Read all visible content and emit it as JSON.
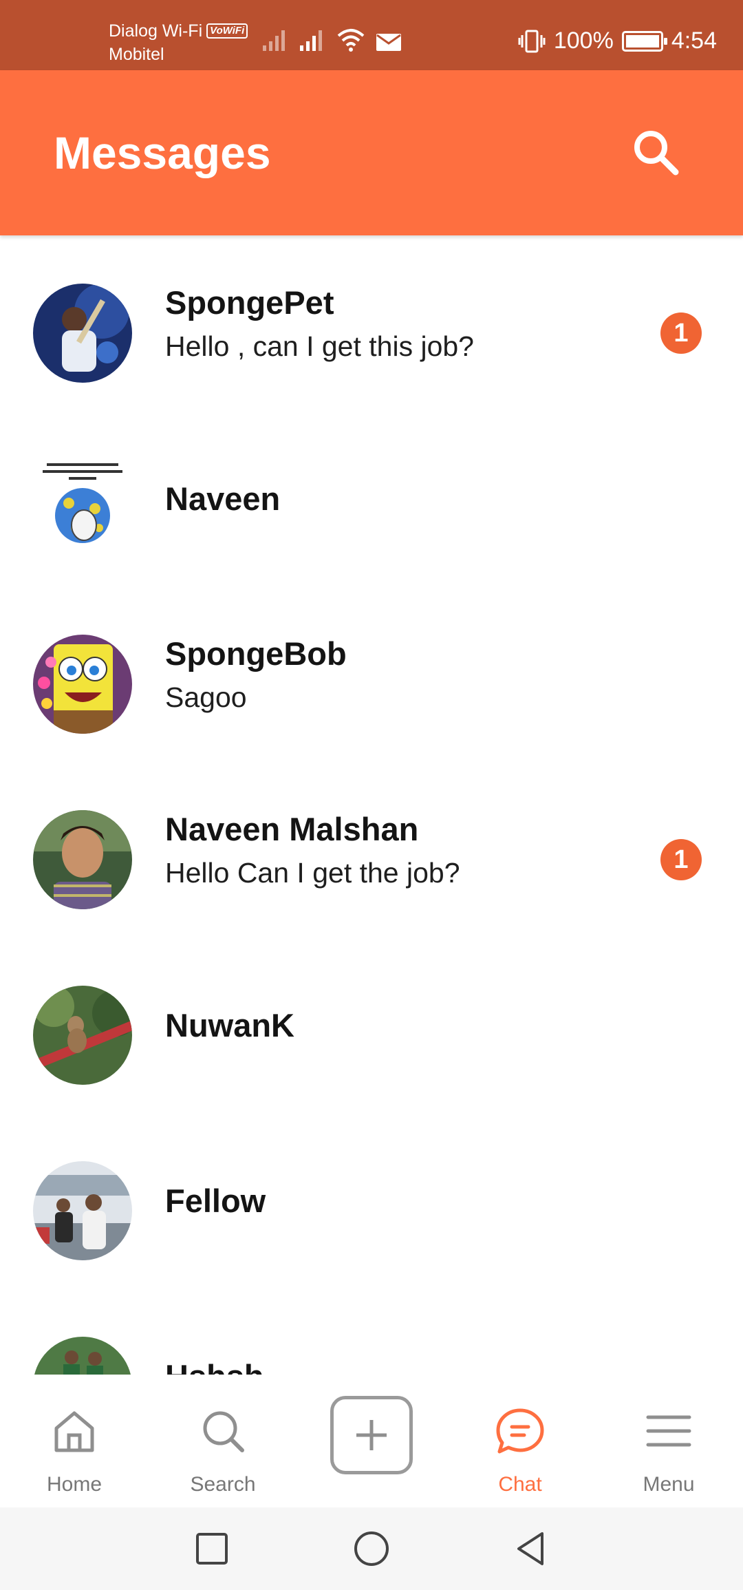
{
  "status_bar": {
    "carrier_1": "Dialog Wi-Fi",
    "vowifi_badge": "VoWiFi",
    "carrier_2": "Mobitel",
    "battery_percent": "100%",
    "time": "4:54"
  },
  "header": {
    "title": "Messages"
  },
  "conversations": [
    {
      "name": "SpongePet",
      "message": "Hello , can I get this job?",
      "unread": "1"
    },
    {
      "name": "Naveen",
      "message": "",
      "unread": ""
    },
    {
      "name": "SpongeBob",
      "message": "Sagoo",
      "unread": ""
    },
    {
      "name": "Naveen Malshan",
      "message": "Hello Can I get the job?",
      "unread": "1"
    },
    {
      "name": "NuwanK",
      "message": "",
      "unread": ""
    },
    {
      "name": "Fellow",
      "message": "",
      "unread": ""
    },
    {
      "name": "Hshsh",
      "message": "",
      "unread": ""
    }
  ],
  "bottom_nav": {
    "home": "Home",
    "search": "Search",
    "chat": "Chat",
    "menu": "Menu"
  },
  "colors": {
    "status_bar": "#b9502f",
    "app_bar": "#fe6f40",
    "accent": "#f06433",
    "inactive_nav": "#777777"
  }
}
